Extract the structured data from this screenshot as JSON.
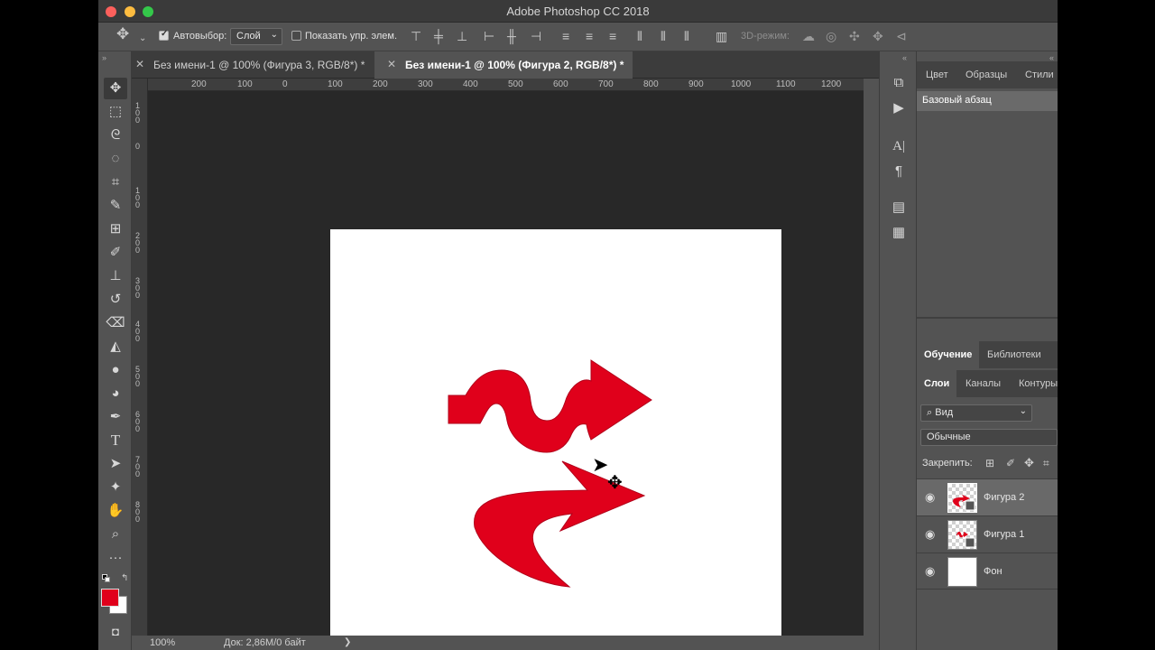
{
  "window": {
    "title": "Adobe Photoshop CC 2018"
  },
  "colors": {
    "foreground": "#e0001b",
    "background": "#ffffff",
    "shape_fill": "#e0001b"
  },
  "options_bar": {
    "auto_select_label": "Автовыбор:",
    "auto_select_checked": true,
    "auto_select_value": "Слой",
    "show_controls_label": "Показать упр. элем.",
    "show_controls_checked": false,
    "mode_3d_label": "3D-режим:"
  },
  "document_tabs": [
    {
      "label": "Без имени-1 @ 100% (Фигура 3, RGB/8*) *",
      "active": false
    },
    {
      "label": "Без имени-1 @ 100% (Фигура 2, RGB/8*) *",
      "active": true
    }
  ],
  "ruler": {
    "top_ticks": [
      "200",
      "100",
      "0",
      "100",
      "200",
      "300",
      "400",
      "500",
      "600",
      "700",
      "800",
      "900",
      "1000",
      "1100",
      "1200"
    ],
    "left_ticks": [
      "1\n0\n0",
      "0",
      "1\n0\n0",
      "2\n0\n0",
      "3\n0\n0",
      "4\n0\n0",
      "5\n0\n0",
      "6\n0\n0",
      "7\n0\n0",
      "8\n0\n0"
    ]
  },
  "status_bar": {
    "zoom": "100%",
    "doc_info": "Док: 2,86M/0 байт",
    "arrow": "❯"
  },
  "right_panel": {
    "top_tabs": [
      "Цвет",
      "Образцы",
      "Стили"
    ],
    "paragraph_style": "Базовый абзац",
    "mid_tabs": [
      "Обучение",
      "Библиотеки"
    ],
    "layer_tabs": [
      "Слои",
      "Каналы",
      "Контуры"
    ],
    "filter_label": "Вид",
    "blend_mode": "Обычные",
    "lock_label": "Закрепить:",
    "layers": [
      {
        "name": "Фигура 2",
        "selected": true,
        "thumb": "arrow-curved"
      },
      {
        "name": "Фигура 1",
        "selected": false,
        "thumb": "arrow-wave"
      },
      {
        "name": "Фон",
        "selected": false,
        "thumb": "white"
      }
    ]
  }
}
